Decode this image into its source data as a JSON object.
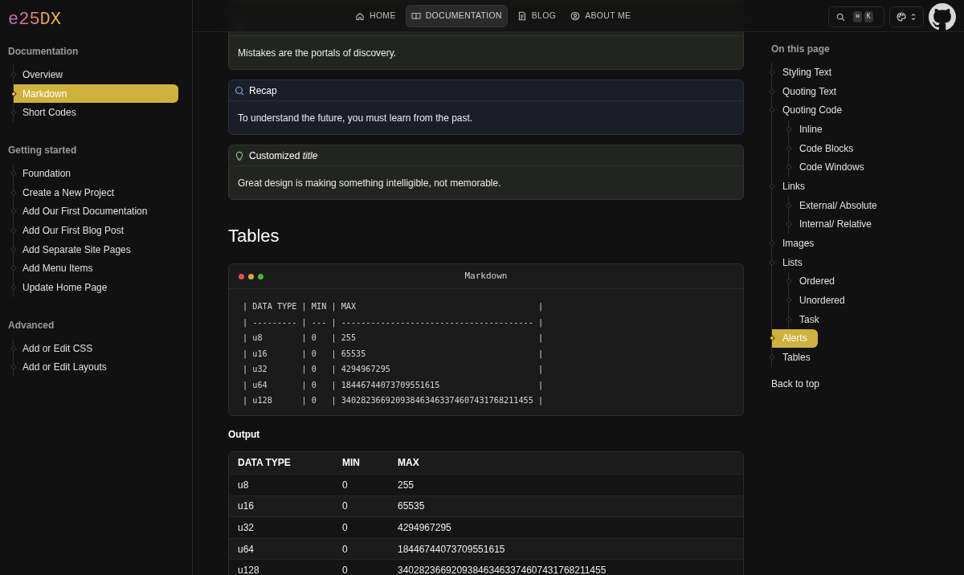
{
  "logo": "e25DX",
  "nav": [
    {
      "label": "HOME",
      "selected": false
    },
    {
      "label": "DOCUMENTATION",
      "selected": true
    },
    {
      "label": "BLOG",
      "selected": false
    },
    {
      "label": "ABOUT ME",
      "selected": false
    }
  ],
  "search": {
    "keys": [
      "⌘",
      "K"
    ]
  },
  "sidebar": [
    {
      "heading": "Documentation",
      "items": [
        {
          "label": "Overview",
          "selected": false
        },
        {
          "label": "Markdown",
          "selected": true
        },
        {
          "label": "Short Codes",
          "selected": false
        }
      ]
    },
    {
      "heading": "Getting started",
      "items": [
        {
          "label": "Foundation",
          "selected": false
        },
        {
          "label": "Create a New Project",
          "selected": false
        },
        {
          "label": "Add Our First Documentation",
          "selected": false
        },
        {
          "label": "Add Our First Blog Post",
          "selected": false
        },
        {
          "label": "Add Separate Site Pages",
          "selected": false
        },
        {
          "label": "Add Menu Items",
          "selected": false
        },
        {
          "label": "Update Home Page",
          "selected": false
        }
      ]
    },
    {
      "heading": "Advanced",
      "items": [
        {
          "label": "Add or Edit CSS",
          "selected": false
        },
        {
          "label": "Add or Edit Layouts",
          "selected": false
        }
      ]
    }
  ],
  "alerts": [
    {
      "kind": "lab",
      "body": "Mistakes are the portals of discovery."
    },
    {
      "kind": "recap",
      "title": "Recap",
      "body": "To understand the future, you must learn from the past."
    },
    {
      "kind": "tip",
      "title": "Customized *title*",
      "body": "Great design is making something intelligible, not memorable."
    }
  ],
  "section_title": "Tables",
  "code_window": {
    "title": "Markdown",
    "lines": [
      "| DATA TYPE | MIN | MAX                                     |",
      "| --------- | --- | --------------------------------------- |",
      "| u8        | 0   | 255                                     |",
      "| u16       | 0   | 65535                                   |",
      "| u32       | 0   | 4294967295                              |",
      "| u64       | 0   | 18446744073709551615                    |",
      "| u128      | 0   | 340282366920938463463374607431768211455 |"
    ]
  },
  "output_label": "Output",
  "table": {
    "columns": [
      "DATA TYPE",
      "MIN",
      "MAX"
    ],
    "rows": [
      [
        "u8",
        "0",
        "255"
      ],
      [
        "u16",
        "0",
        "65535"
      ],
      [
        "u32",
        "0",
        "4294967295"
      ],
      [
        "u64",
        "0",
        "18446744073709551615"
      ],
      [
        "u128",
        "0",
        "340282366920938463463374607431768211455"
      ]
    ]
  },
  "toc": {
    "heading": "On this page",
    "items": [
      {
        "label": "Styling Text",
        "selected": false
      },
      {
        "label": "Quoting Text",
        "selected": false
      },
      {
        "label": "Quoting Code",
        "selected": false,
        "children": [
          {
            "label": "Inline",
            "selected": false
          },
          {
            "label": "Code Blocks",
            "selected": false
          },
          {
            "label": "Code Windows",
            "selected": false
          }
        ]
      },
      {
        "label": "Links",
        "selected": false,
        "children": [
          {
            "label": "External/ Absolute",
            "selected": false
          },
          {
            "label": "Internal/ Relative",
            "selected": false
          }
        ]
      },
      {
        "label": "Images",
        "selected": false
      },
      {
        "label": "Lists",
        "selected": false,
        "children": [
          {
            "label": "Ordered",
            "selected": false
          },
          {
            "label": "Unordered",
            "selected": false
          },
          {
            "label": "Task",
            "selected": false
          }
        ]
      },
      {
        "label": "Alerts",
        "selected": true
      },
      {
        "label": "Tables",
        "selected": false
      }
    ],
    "back_to_top": "Back to top"
  }
}
